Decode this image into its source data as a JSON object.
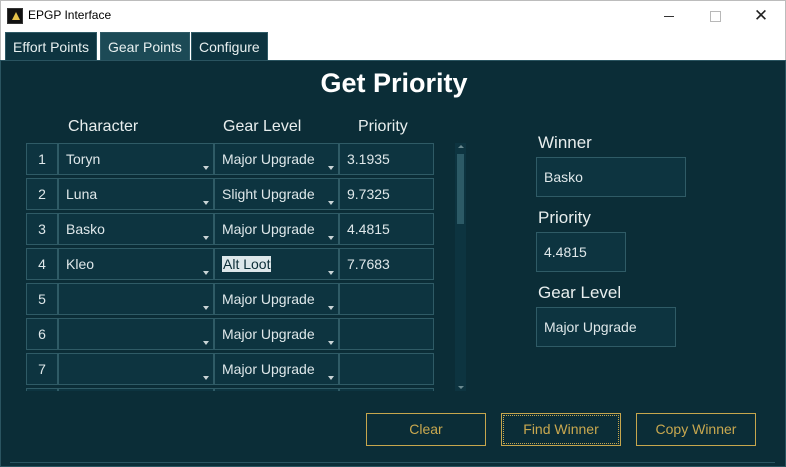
{
  "window": {
    "title": "EPGP Interface",
    "close_glyph": "✕"
  },
  "tabs": [
    {
      "label": "Effort Points"
    },
    {
      "label": "Gear Points"
    },
    {
      "label": "Configure"
    }
  ],
  "page_title": "Get Priority",
  "columns": {
    "character": "Character",
    "gear_level": "Gear Level",
    "priority": "Priority"
  },
  "rows": [
    {
      "num": "1",
      "character": "Toryn",
      "gear_level": "Major Upgrade",
      "priority": "3.1935"
    },
    {
      "num": "2",
      "character": "Luna",
      "gear_level": "Slight Upgrade",
      "priority": "9.7325"
    },
    {
      "num": "3",
      "character": "Basko",
      "gear_level": "Major Upgrade",
      "priority": "4.4815"
    },
    {
      "num": "4",
      "character": "Kleo",
      "gear_level": "Alt Loot",
      "priority": "7.7683"
    },
    {
      "num": "5",
      "character": "",
      "gear_level": "Major Upgrade",
      "priority": ""
    },
    {
      "num": "6",
      "character": "",
      "gear_level": "Major Upgrade",
      "priority": ""
    },
    {
      "num": "7",
      "character": "",
      "gear_level": "Major Upgrade",
      "priority": ""
    },
    {
      "num": "",
      "character": "",
      "gear_level": "",
      "priority": ""
    }
  ],
  "result": {
    "winner_label": "Winner",
    "winner_value": "Basko",
    "priority_label": "Priority",
    "priority_value": "4.4815",
    "gear_level_label": "Gear Level",
    "gear_level_value": "Major Upgrade"
  },
  "buttons": {
    "clear": "Clear",
    "find_winner": "Find Winner",
    "copy_winner": "Copy Winner"
  },
  "colors": {
    "background": "#0b2d37",
    "accent": "#c9a84f",
    "field": "#0d3440"
  }
}
